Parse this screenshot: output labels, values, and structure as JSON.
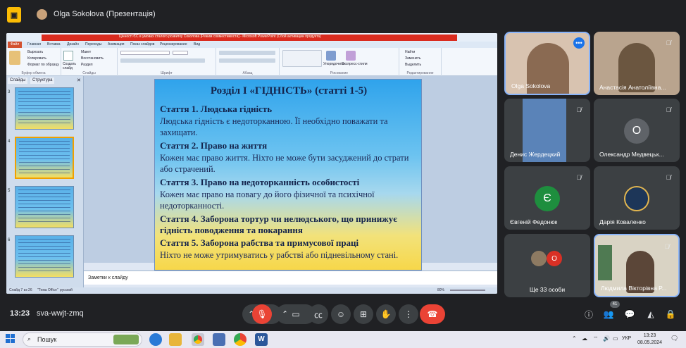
{
  "window": {
    "presenter_title": "Olga Sokolova (Презентація)"
  },
  "powerpoint": {
    "title_bar": "Цінності ЄС в умовах сталого розвитку Соколова [Режим совместимости] - Microsoft PowerPoint (Сбой активации продукта)",
    "file_tab": "Файл",
    "menu": [
      "Главная",
      "Вставка",
      "Дизайн",
      "Переходы",
      "Анимация",
      "Показ слайдов",
      "Рецензирование",
      "Вид"
    ],
    "ribbon_groups": [
      "Буфер обмена",
      "Слайды",
      "Шрифт",
      "Абзац",
      "Рисование",
      "Редактирование"
    ],
    "ribbon_buttons": {
      "paste": "Вставить",
      "cut": "Вырезать",
      "copy": "Копировать",
      "format_painter": "Формат по образцу",
      "new_slide": "Создать слайд",
      "layout": "Макет",
      "reset": "Восстановить",
      "section": "Раздел",
      "arrange": "Упорядочить",
      "quick_styles": "Экспресс-стили",
      "find": "Найти",
      "replace": "Заменить",
      "select": "Выделить"
    },
    "side_tabs": [
      "Слайды",
      "Структура"
    ],
    "thumbnail_numbers": [
      "3",
      "4",
      "5",
      "6"
    ],
    "notes_placeholder": "Заметки к слайду",
    "status": {
      "slide_info": "Слайд 7 из 26",
      "theme": "\"Тема Office\"",
      "language": "русский",
      "zoom": "80%"
    }
  },
  "slide": {
    "title": "Розділ І «ГІДНІСТЬ» (статті 1-5)",
    "lines": [
      {
        "kind": "h",
        "text": "Стаття 1. Людська гідність"
      },
      {
        "kind": "t",
        "text": "Людська гідність є недоторканною. Її необхідно поважати та"
      },
      {
        "kind": "t",
        "text": "захищати."
      },
      {
        "kind": "h",
        "text": "Стаття 2. Право на життя"
      },
      {
        "kind": "t",
        "text": "Кожен має право життя. Ніхто не може бути засуджений до страти"
      },
      {
        "kind": "t",
        "text": "або страчений."
      },
      {
        "kind": "h",
        "text": "Стаття 3. Право на недоторканність особистості"
      },
      {
        "kind": "t",
        "text": "Кожен має право на повагу до його фізичної та психічної"
      },
      {
        "kind": "t",
        "text": "недоторканності."
      },
      {
        "kind": "h",
        "text": "Стаття 4. Заборона  тортур чи нелюдського, що принижує"
      },
      {
        "kind": "h",
        "text": "гідність поводження та покарання"
      },
      {
        "kind": "h",
        "text": "Стаття 5. Заборона  рабства та примусової праці"
      },
      {
        "kind": "t",
        "text": "Ніхто не може утримуватись у рабстві або підневільному стані."
      }
    ]
  },
  "participants": [
    {
      "name": "Olga Sokolova",
      "type": "video"
    },
    {
      "name": "Анастасія Анатоліївна...",
      "type": "video"
    },
    {
      "name": "Денис Жердецкий",
      "type": "video"
    },
    {
      "name": "Олександр Медвецьк...",
      "type": "letter",
      "letter": "О",
      "color": "#5f6368"
    },
    {
      "name": "Євгеній Федонюк",
      "type": "letter",
      "letter": "Є",
      "color": "#1e8e3e"
    },
    {
      "name": "Дарія Коваленко",
      "type": "photo"
    },
    {
      "name": "Ще 33 особи",
      "type": "more",
      "letter": "О"
    },
    {
      "name": "Людмила Вікторівна Р...",
      "type": "video"
    }
  ],
  "meeting": {
    "time": "13:23",
    "code": "sva-wwjt-zmq",
    "participant_count": "41"
  },
  "taskbar": {
    "search_placeholder": "Пошук",
    "language": "УКР",
    "time": "13:23",
    "date": "08.05.2024"
  },
  "colors": {
    "meet_bg": "#202124",
    "tile_bg": "#3c4043",
    "end_call": "#ea4335",
    "accent_blue": "#8ab4f8"
  }
}
